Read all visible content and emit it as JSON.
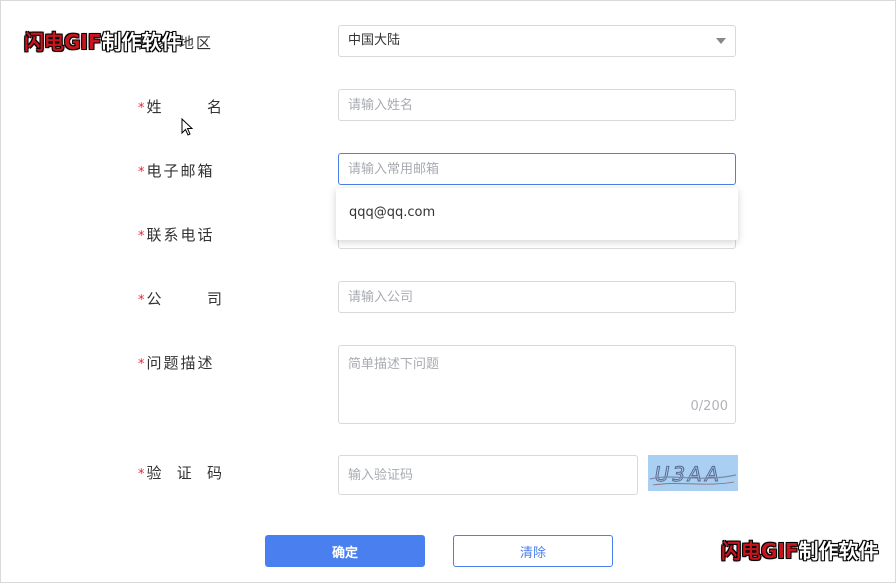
{
  "watermark": {
    "brand": "闪电GIF",
    "suffix": "制作软件"
  },
  "form": {
    "country": {
      "label": "国家/地区",
      "value": "中国大陆"
    },
    "name": {
      "label": "姓名",
      "placeholder": "请输入姓名"
    },
    "email": {
      "label": "电子邮箱",
      "placeholder": "请输入常用邮箱",
      "suggestion": "qqq@qq.com"
    },
    "phone": {
      "label": "联系电话"
    },
    "company": {
      "label": "公司",
      "placeholder": "请输入公司"
    },
    "question": {
      "label": "问题描述",
      "placeholder": "简单描述下问题",
      "counter": "0/200"
    },
    "captcha": {
      "label": "验证码",
      "placeholder": "输入验证码",
      "image_text": "U3AA"
    },
    "required_mark": "*"
  },
  "buttons": {
    "confirm": "确定",
    "clear": "清除"
  },
  "colors": {
    "primary": "#4a7ff0",
    "required": "#f5222d",
    "captcha_bg": "#a9cff2"
  }
}
